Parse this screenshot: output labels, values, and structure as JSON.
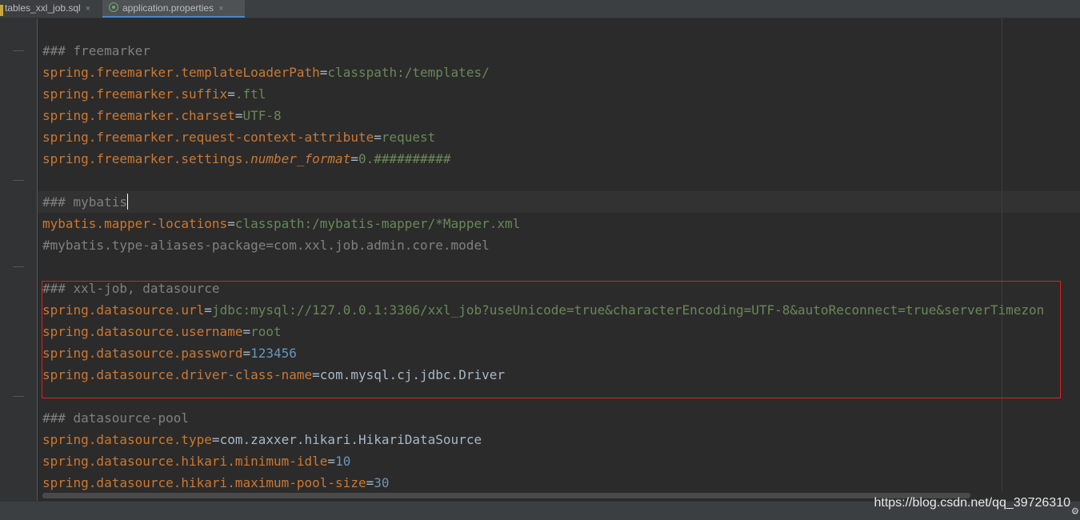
{
  "tabs": [
    {
      "label": "tables_xxl_job.sql",
      "close": "×",
      "active": false
    },
    {
      "label": "application.properties",
      "close": "×",
      "active": true
    }
  ],
  "lines": {
    "l1": {
      "comment": "### freemarker"
    },
    "l2": {
      "key": "spring.freemarker.templateLoaderPath",
      "eq": "=",
      "value": "classpath:/templates/"
    },
    "l3": {
      "key": "spring.freemarker.suffix",
      "eq": "=",
      "value": ".ftl"
    },
    "l4": {
      "key": "spring.freemarker.charset",
      "eq": "=",
      "value": "UTF-8"
    },
    "l5": {
      "key": "spring.freemarker.request-context-attribute",
      "eq": "=",
      "value": "request"
    },
    "l6": {
      "key": "spring.freemarker.settings.",
      "key_italic": "number_format",
      "eq": "=",
      "value": "0.##########"
    },
    "l7": {
      "comment": "### mybatis"
    },
    "l8": {
      "key": "mybatis.mapper-locations",
      "eq": "=",
      "value": "classpath:/mybatis-mapper/*Mapper.xml"
    },
    "l9": {
      "comment": "#mybatis.type-aliases-package=com.xxl.job.admin.core.model"
    },
    "l10": {
      "comment": "### xxl-job, datasource"
    },
    "l11": {
      "key": "spring.datasource.url",
      "eq": "=",
      "value": "jdbc:mysql://127.0.0.1:3306/xxl_job?useUnicode=true&characterEncoding=UTF-8&autoReconnect=true&serverTimezon"
    },
    "l12": {
      "key": "spring.datasource.username",
      "eq": "=",
      "value": "root"
    },
    "l13": {
      "key": "spring.datasource.password",
      "eq": "=",
      "value": "123456"
    },
    "l14": {
      "key": "spring.datasource.driver-class-name",
      "eq": "=",
      "value": "com.mysql.cj.jdbc.Driver"
    },
    "l15": {
      "comment": "### datasource-pool"
    },
    "l16": {
      "key": "spring.datasource.type",
      "eq": "=",
      "value": "com.zaxxer.hikari.HikariDataSource"
    },
    "l17": {
      "key": "spring.datasource.hikari.minimum-idle",
      "eq": "=",
      "value": "10"
    },
    "l18": {
      "key": "spring.datasource.hikari.maximum-pool-size",
      "eq": "=",
      "value": "30"
    }
  },
  "watermark": "https://blog.csdn.net/qq_39726310",
  "icons": {
    "settings": "gear-icon",
    "file_sql": "sql-file-icon",
    "file_spring": "spring-leaf-icon"
  },
  "colors": {
    "highlight_box": "#e02020",
    "key": "#cc7832",
    "value": "#6a8759",
    "comment": "#808080"
  }
}
